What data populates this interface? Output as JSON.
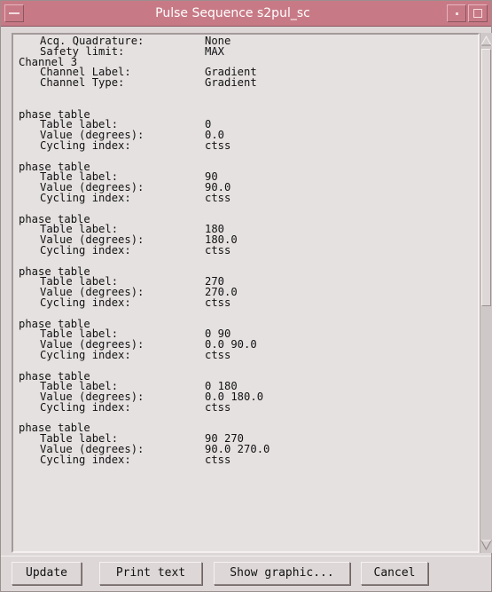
{
  "window": {
    "title": "Pulse Sequence s2pul_sc"
  },
  "header_lines": [
    {
      "indent": true,
      "key": "Acq. Quadrature:",
      "value": "None"
    },
    {
      "indent": true,
      "key": "Safety limit:",
      "value": "MAX"
    },
    {
      "indent": false,
      "key": "Channel 3",
      "value": ""
    },
    {
      "indent": true,
      "key": "Channel Label:",
      "value": "Gradient"
    },
    {
      "indent": true,
      "key": "Channel Type:",
      "value": "Gradient"
    }
  ],
  "phase_tables": [
    {
      "heading": "phase table",
      "label_key": "Table label:",
      "label": "0",
      "value_key": "Value (degrees):",
      "value": "0.0",
      "cycling_key": "Cycling index:",
      "cycling": "ctss"
    },
    {
      "heading": "phase table",
      "label_key": "Table label:",
      "label": "90",
      "value_key": "Value (degrees):",
      "value": "90.0",
      "cycling_key": "Cycling index:",
      "cycling": "ctss"
    },
    {
      "heading": "phase table",
      "label_key": "Table label:",
      "label": "180",
      "value_key": "Value (degrees):",
      "value": "180.0",
      "cycling_key": "Cycling index:",
      "cycling": "ctss"
    },
    {
      "heading": "phase table",
      "label_key": "Table label:",
      "label": "270",
      "value_key": "Value (degrees):",
      "value": "270.0",
      "cycling_key": "Cycling index:",
      "cycling": "ctss"
    },
    {
      "heading": "phase table",
      "label_key": "Table label:",
      "label": "0 90",
      "value_key": "Value (degrees):",
      "value": "0.0 90.0",
      "cycling_key": "Cycling index:",
      "cycling": "ctss"
    },
    {
      "heading": "phase table",
      "label_key": "Table label:",
      "label": "0 180",
      "value_key": "Value (degrees):",
      "value": "0.0 180.0",
      "cycling_key": "Cycling index:",
      "cycling": "ctss"
    },
    {
      "heading": "phase table",
      "label_key": "Table label:",
      "label": "90 270",
      "value_key": "Value (degrees):",
      "value": "90.0 270.0",
      "cycling_key": "Cycling index:",
      "cycling": "ctss"
    }
  ],
  "buttons": {
    "update": "Update",
    "print_text": "Print text",
    "show_graphic": "Show graphic...",
    "cancel": "Cancel"
  },
  "icons": {
    "window_menu": "window-menu-icon",
    "minimize": "minimize-icon",
    "maximize": "maximize-icon",
    "scroll_up": "scroll-up-arrow-icon",
    "scroll_down": "scroll-down-arrow-icon"
  },
  "colors": {
    "titlebar": "#c77a86",
    "background": "#ddd7d7",
    "text_area": "#e6e1e1"
  }
}
